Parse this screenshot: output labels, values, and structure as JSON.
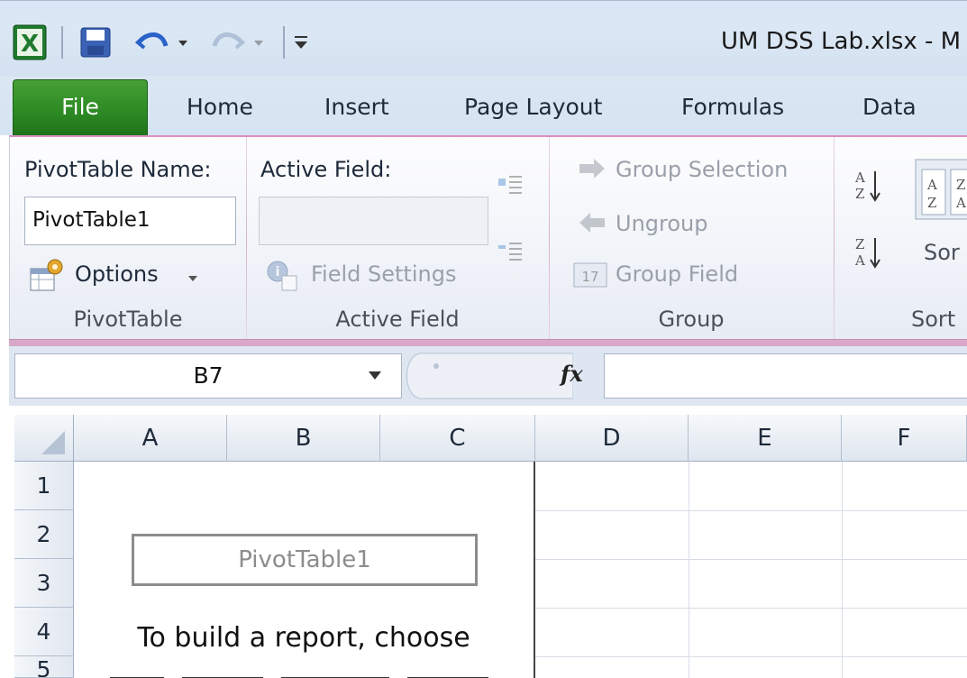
{
  "window": {
    "title": "UM DSS Lab.xlsx  -  M"
  },
  "tabs": [
    "File",
    "Home",
    "Insert",
    "Page Layout",
    "Formulas",
    "Data"
  ],
  "ribbon": {
    "pivottable": {
      "name_label": "PivotTable Name:",
      "name_value": "PivotTable1",
      "options_label": "Options",
      "group_label": "PivotTable"
    },
    "active_field": {
      "label": "Active Field:",
      "value": "",
      "field_settings_label": "Field Settings",
      "group_label": "Active Field"
    },
    "group": {
      "group_selection_label": "Group Selection",
      "ungroup_label": "Ungroup",
      "group_field_label": "Group Field",
      "group_label": "Group"
    },
    "sort": {
      "sort_label": "Sor",
      "group_label": "Sort"
    }
  },
  "formula_bar": {
    "name_box": "B7",
    "fx_label": "fx",
    "formula": ""
  },
  "grid": {
    "columns": [
      "A",
      "B",
      "C",
      "D",
      "E",
      "F"
    ],
    "rows": [
      "1",
      "2",
      "3",
      "4",
      "5"
    ],
    "pivot_title": "PivotTable1",
    "pivot_instruction": "To build a report, choose"
  },
  "colors": {
    "file_tab": "#2d8a24",
    "ribbon_accent": "#d98fc1",
    "chrome": "#dbe7f4"
  }
}
